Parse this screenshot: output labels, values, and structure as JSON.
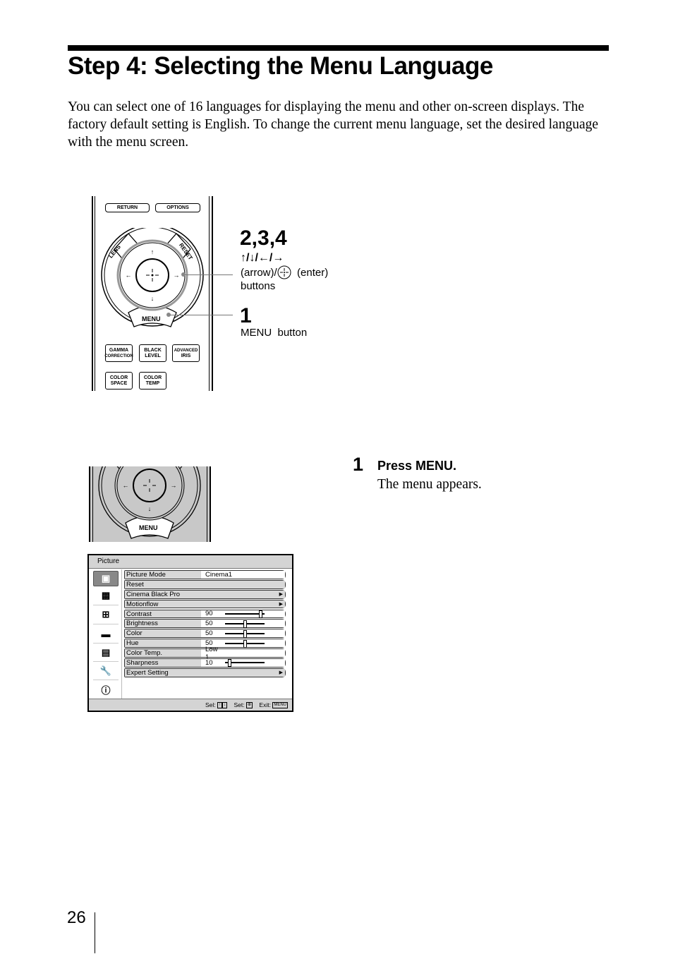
{
  "header": {
    "title": "Step 4: Selecting the Menu Language"
  },
  "intro": "You can select one of 16 languages for displaying the menu and other on-screen displays. The factory default setting is English. To change the current menu language, set the desired language with the menu screen.",
  "remote": {
    "buttons": {
      "return": "RETURN",
      "options": "OPTIONS",
      "lens": "LENS",
      "reset": "RESET",
      "menu": "MENU",
      "gamma_1": "GAMMA",
      "gamma_2": "CORRECTION",
      "black_1": "BLACK",
      "black_2": "LEVEL",
      "iris_1": "ADVANCED",
      "iris_2": "IRIS",
      "space_1": "COLOR",
      "space_2": "SPACE",
      "temp_1": "COLOR",
      "temp_2": "TEMP"
    },
    "callouts": [
      {
        "number": "2,3,4",
        "arrows": "↑/↓/←/→",
        "line1_a": "(arrow)/",
        "line1_b": "(enter)",
        "line2": "buttons"
      },
      {
        "number": "1",
        "line1": "MENU  button"
      }
    ]
  },
  "steps": [
    {
      "number": "1",
      "heading": "Press MENU.",
      "body": "The menu appears."
    }
  ],
  "osd_menu": {
    "title": "Picture",
    "side_icons": [
      "picture-icon",
      "advanced-picture-icon",
      "screen-icon",
      "setup-icon",
      "function-icon",
      "installation-icon",
      "information-icon"
    ],
    "rows": [
      {
        "label": "Picture Mode",
        "value": "Cinema1",
        "type": "value"
      },
      {
        "label": "Reset",
        "value": "",
        "type": "full"
      },
      {
        "label": "Cinema Black Pro",
        "value": "",
        "type": "submenu"
      },
      {
        "label": "Motionflow",
        "value": "",
        "type": "submenu"
      },
      {
        "label": "Contrast",
        "value": "90",
        "type": "slider",
        "level": 0.9
      },
      {
        "label": "Brightness",
        "value": "50",
        "type": "slider",
        "level": 0.5
      },
      {
        "label": "Color",
        "value": "50",
        "type": "slider",
        "level": 0.5
      },
      {
        "label": "Hue",
        "value": "50",
        "type": "slider",
        "level": 0.5
      },
      {
        "label": "Color Temp.",
        "value": "Low 1",
        "type": "value"
      },
      {
        "label": "Sharpness",
        "value": "10",
        "type": "slider",
        "level": 0.1
      },
      {
        "label": "Expert Setting",
        "value": "",
        "type": "submenu"
      }
    ],
    "footer": {
      "sel_label": "Sel:",
      "set_label": "Set:",
      "exit_label": "Exit:",
      "exit_key": "MENU"
    }
  },
  "page_number": "26"
}
